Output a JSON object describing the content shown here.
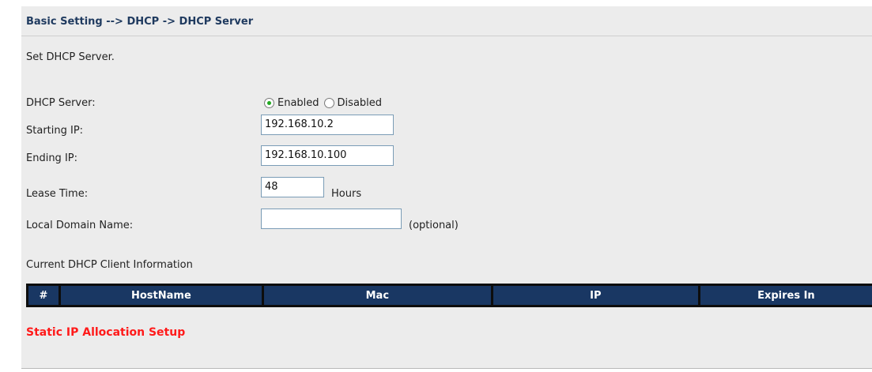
{
  "breadcrumb": "Basic Setting --> DHCP -> DHCP Server",
  "description": "Set DHCP Server.",
  "form": {
    "dhcp_server": {
      "label": "DHCP Server:",
      "options": [
        "Enabled",
        "Disabled"
      ],
      "selected": "Enabled"
    },
    "starting_ip": {
      "label": "Starting IP:",
      "value": "192.168.10.2"
    },
    "ending_ip": {
      "label": "Ending IP:",
      "value": "192.168.10.100"
    },
    "lease_time": {
      "label": "Lease Time:",
      "value": "48",
      "unit": "Hours"
    },
    "local_domain": {
      "label": "Local Domain Name:",
      "value": "",
      "note": "(optional)"
    }
  },
  "client_info": {
    "title": "Current DHCP Client Information",
    "columns": [
      "#",
      "HostName",
      "Mac",
      "IP",
      "Expires In"
    ],
    "rows": []
  },
  "static_ip_link": "Static IP Allocation Setup",
  "colors": {
    "table_header_bg": "#193763",
    "link": "#ff1a1a",
    "radio_selected": "#22a922",
    "breadcrumb": "#1f3a5f"
  }
}
